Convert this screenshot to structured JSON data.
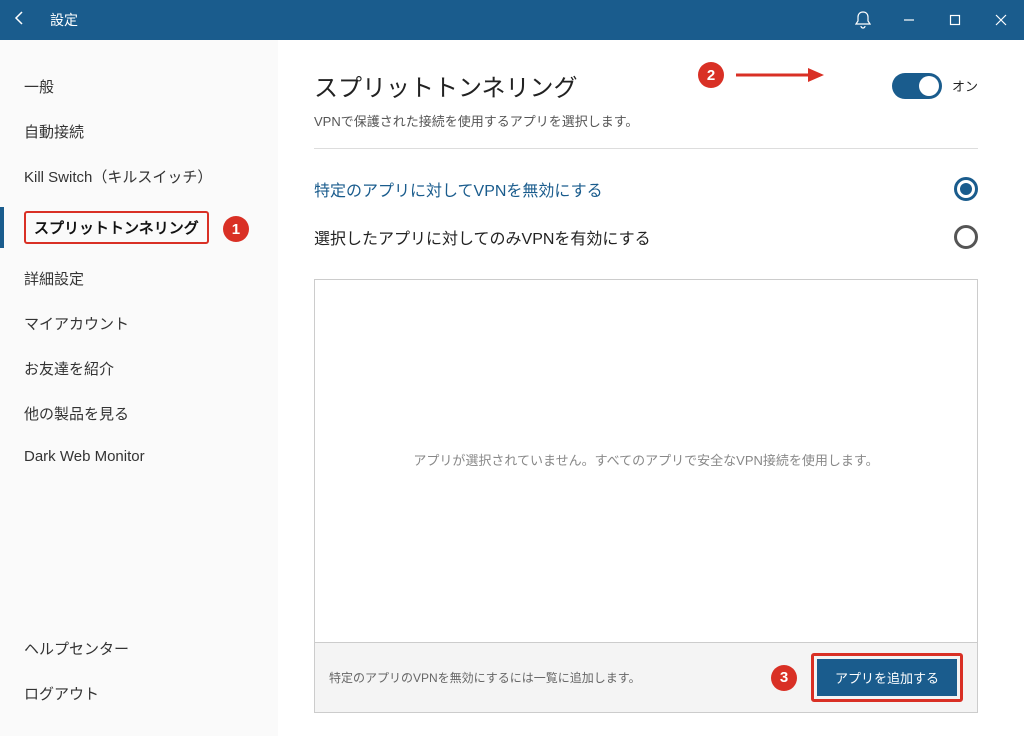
{
  "titlebar": {
    "title": "設定"
  },
  "sidebar": {
    "items": [
      {
        "label": "一般"
      },
      {
        "label": "自動接続"
      },
      {
        "label": "Kill Switch（キルスイッチ）"
      },
      {
        "label": "スプリットトンネリング"
      },
      {
        "label": "詳細設定"
      },
      {
        "label": "マイアカウント"
      },
      {
        "label": "お友達を紹介"
      },
      {
        "label": "他の製品を見る"
      },
      {
        "label": "Dark Web Monitor"
      }
    ],
    "bottom": [
      {
        "label": "ヘルプセンター"
      },
      {
        "label": "ログアウト"
      }
    ]
  },
  "content": {
    "heading": "スプリットトンネリング",
    "subhead": "VPNで保護された接続を使用するアプリを選択します。",
    "toggle_label": "オン",
    "options": [
      {
        "label": "特定のアプリに対してVPNを無効にする"
      },
      {
        "label": "選択したアプリに対してのみVPNを有効にする"
      }
    ],
    "empty_text": "アプリが選択されていません。すべてのアプリで安全なVPN接続を使用します。",
    "footer_hint": "特定のアプリのVPNを無効にするには一覧に追加します。",
    "add_button": "アプリを追加する"
  },
  "annotations": {
    "step1": "1",
    "step2": "2",
    "step3": "3"
  }
}
